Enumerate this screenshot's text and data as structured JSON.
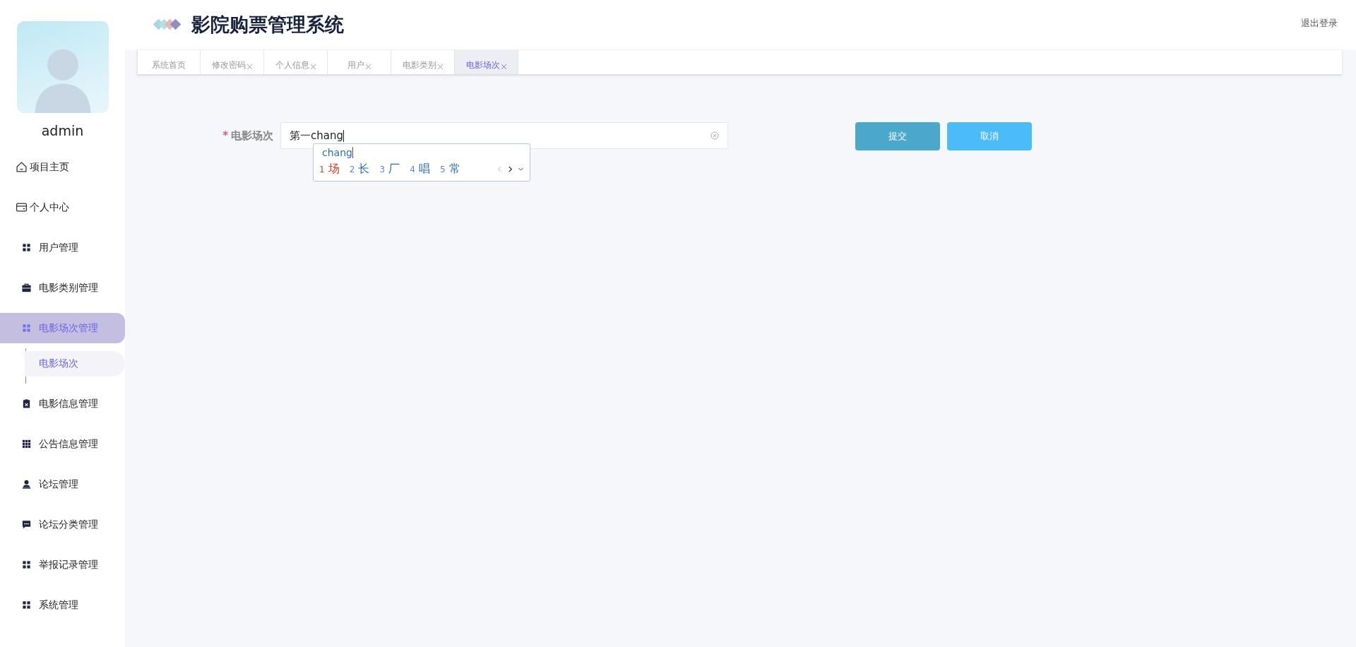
{
  "sidebar": {
    "user_name": "admin",
    "items": [
      {
        "label": "项目主页",
        "selected": false
      },
      {
        "label": "个人中心",
        "selected": false
      },
      {
        "label": "用户管理",
        "selected": false
      },
      {
        "label": "电影类别管理",
        "selected": false
      },
      {
        "label": "电影场次管理",
        "selected": true,
        "children": [
          {
            "label": "电影场次",
            "selected": true
          }
        ]
      },
      {
        "label": "电影信息管理",
        "selected": false
      },
      {
        "label": "公告信息管理",
        "selected": false
      },
      {
        "label": "论坛管理",
        "selected": false
      },
      {
        "label": "论坛分类管理",
        "selected": false
      },
      {
        "label": "举报记录管理",
        "selected": false
      },
      {
        "label": "系统管理",
        "selected": false
      }
    ]
  },
  "header": {
    "title": "影院购票管理系统",
    "logout": "退出登录"
  },
  "tabs": [
    {
      "label": "系统首页",
      "selected": false,
      "closable": false
    },
    {
      "label": "修改密码",
      "selected": false,
      "closable": true
    },
    {
      "label": "个人信息",
      "selected": false,
      "closable": true
    },
    {
      "label": "用户",
      "selected": false,
      "closable": true
    },
    {
      "label": "电影类别",
      "selected": false,
      "closable": true
    },
    {
      "label": "电影场次",
      "selected": true,
      "closable": true
    }
  ],
  "form": {
    "field": {
      "label": "电影场次",
      "required_mark": "*",
      "value": "第一chang"
    },
    "ime": {
      "composition": "chang",
      "candidates": [
        {
          "number": "1",
          "text": "场",
          "selected": true
        },
        {
          "number": "2",
          "text": "长",
          "selected": false
        },
        {
          "number": "3",
          "text": "厂",
          "selected": false
        },
        {
          "number": "4",
          "text": "唱",
          "selected": false
        },
        {
          "number": "5",
          "text": "常",
          "selected": false
        }
      ]
    },
    "buttons": [
      {
        "label": "提交",
        "kind": "submit"
      },
      {
        "label": "取消",
        "kind": "cancel"
      }
    ]
  }
}
